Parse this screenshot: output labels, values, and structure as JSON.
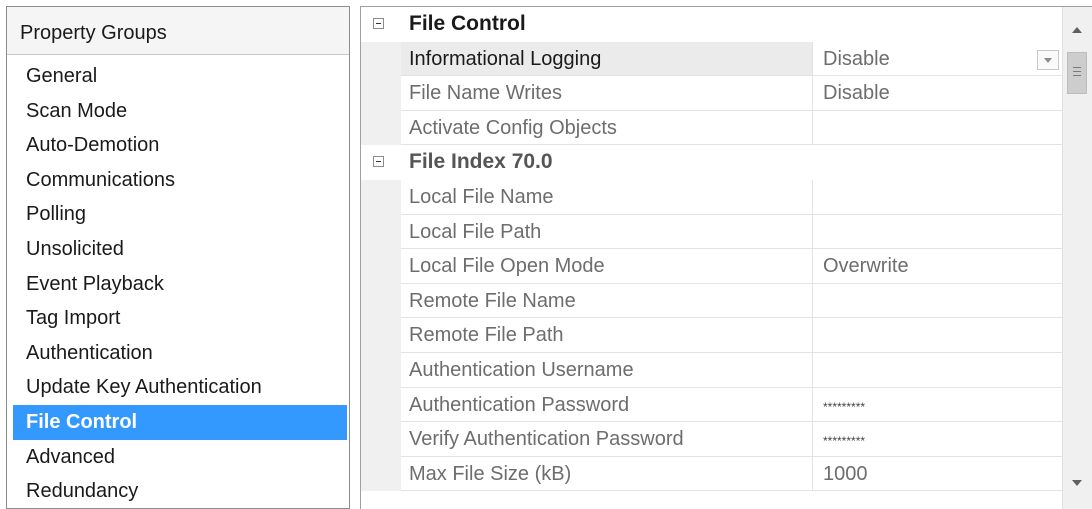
{
  "property_groups": {
    "header": "Property Groups",
    "items": [
      {
        "label": "General",
        "selected": false
      },
      {
        "label": "Scan Mode",
        "selected": false
      },
      {
        "label": "Auto-Demotion",
        "selected": false
      },
      {
        "label": "Communications",
        "selected": false
      },
      {
        "label": "Polling",
        "selected": false
      },
      {
        "label": "Unsolicited",
        "selected": false
      },
      {
        "label": "Event Playback",
        "selected": false
      },
      {
        "label": "Tag Import",
        "selected": false
      },
      {
        "label": "Authentication",
        "selected": false
      },
      {
        "label": "Update Key Authentication",
        "selected": false
      },
      {
        "label": "File Control",
        "selected": true
      },
      {
        "label": "Advanced",
        "selected": false
      },
      {
        "label": "Redundancy",
        "selected": false
      }
    ]
  },
  "properties": {
    "categories": [
      {
        "title": "File Control",
        "rows": [
          {
            "name": "Informational Logging",
            "value": "Disable",
            "selected": true,
            "dropdown": true
          },
          {
            "name": "File Name Writes",
            "value": "Disable"
          },
          {
            "name": "Activate Config Objects",
            "value": ""
          }
        ]
      },
      {
        "title": "File Index 70.0",
        "rows": [
          {
            "name": "Local File Name",
            "value": ""
          },
          {
            "name": "Local File Path",
            "value": ""
          },
          {
            "name": "Local File Open Mode",
            "value": "Overwrite"
          },
          {
            "name": "Remote File Name",
            "value": ""
          },
          {
            "name": "Remote File Path",
            "value": ""
          },
          {
            "name": "Authentication Username",
            "value": ""
          },
          {
            "name": "Authentication Password",
            "value": "*********",
            "masked": true
          },
          {
            "name": "Verify Authentication Password",
            "value": "*********",
            "masked": true
          },
          {
            "name": "Max File Size (kB)",
            "value": "1000"
          }
        ]
      }
    ]
  },
  "icons": {
    "collapse": "collapse-minus-icon",
    "dropdown": "chevron-down-icon",
    "scroll_up": "scroll-up-arrow-icon",
    "scroll_down": "scroll-down-arrow-icon"
  },
  "colors": {
    "selection": "#3399ff",
    "selected_row": "#ebebeb"
  }
}
